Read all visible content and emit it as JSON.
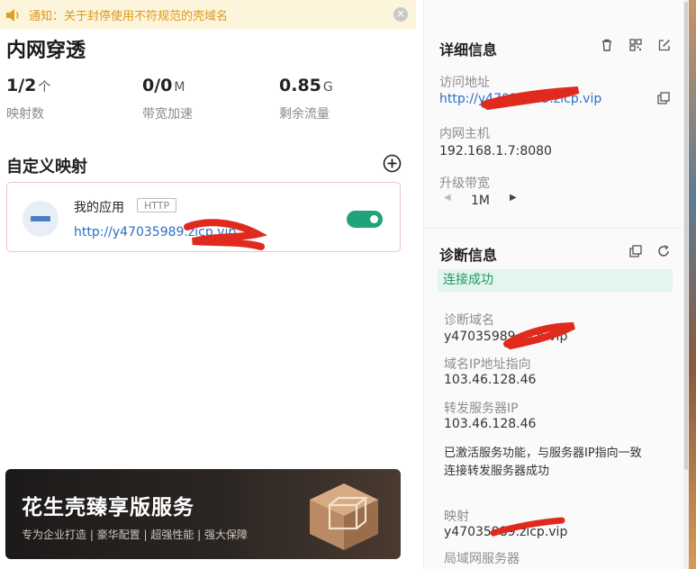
{
  "notice": {
    "text": "通知：关于封停使用不符规范的壳域名"
  },
  "app_title": "内网穿透",
  "stats": [
    {
      "value": "1/2",
      "unit": "个",
      "label": "映射数"
    },
    {
      "value": "0/0",
      "unit": "M",
      "label": "带宽加速"
    },
    {
      "value": "0.85",
      "unit": "G",
      "label": "剩余流量"
    }
  ],
  "custom_section": {
    "title": "自定义映射"
  },
  "mapping": {
    "name": "我的应用",
    "protocol": "HTTP",
    "url": "http://y47035989.zicp.vip",
    "enabled": true
  },
  "banner": {
    "title": "花生壳臻享版服务",
    "subtitle": "专为企业打造 | 豪华配置 | 超强性能 | 强大保障"
  },
  "details": {
    "title": "详细信息",
    "access_label": "访问地址",
    "access_value": "http://y47035989.zicp.vip",
    "host_label": "内网主机",
    "host_value": "192.168.1.7:8080",
    "bw_label": "升级带宽",
    "bw_value": "1M"
  },
  "diagnosis": {
    "title": "诊断信息",
    "status": "连接成功",
    "domain_label": "诊断域名",
    "domain_value": "y47035989.zicp.vip",
    "ip_label": "域名IP地址指向",
    "ip_value": "103.46.128.46",
    "fwd_label": "转发服务器IP",
    "fwd_value": "103.46.128.46",
    "message_1": "已激活服务功能，与服务器IP指向一致",
    "message_2": "连接转发服务器成功",
    "map_label": "映射",
    "map_value": "y47035989.zicp.vip",
    "lan_label": "局域网服务器"
  },
  "colors": {
    "accent_blue": "#2a6fc8",
    "success_green": "#1d9a63",
    "toggle_green": "#1fa37a",
    "notice_orange": "#d99a1c"
  }
}
